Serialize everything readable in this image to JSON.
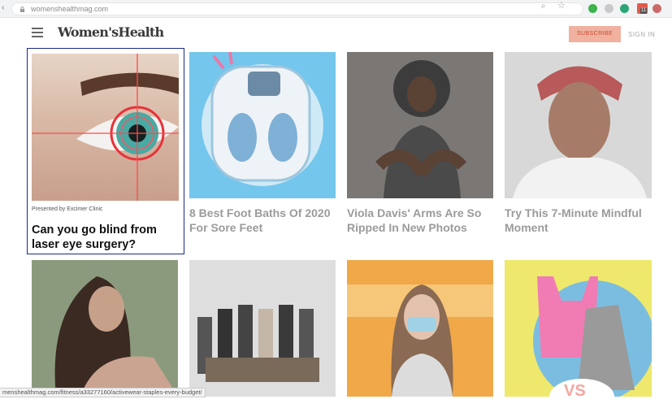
{
  "browser": {
    "url": "womenshealthmag.com",
    "status_url": "menshealthmag.com/fitness/a33277160/activewear-staples-every-budget/"
  },
  "header": {
    "logo": "Women'sHealth",
    "subscribe_label": "SUBSCRIBE",
    "signin_label": "SIGN IN"
  },
  "cards": [
    {
      "sponsor": "Presented by Excimer Clinic",
      "title": "Can you go blind from laser eye surgery?"
    },
    {
      "title": "8 Best Foot Baths Of 2020 For Sore Feet"
    },
    {
      "title": "Viola Davis' Arms Are So Ripped In New Photos"
    },
    {
      "title": "Try This 7-Minute Mindful Moment"
    }
  ],
  "bottom_tiles": [
    {
      "overlay_text": ""
    },
    {
      "overlay_text": ""
    },
    {
      "overlay_text": ""
    },
    {
      "overlay_text": "VS"
    }
  ],
  "colors": {
    "accent": "#f0b19f",
    "subscribe_text": "#c94a30",
    "featured_border": "#1a2a8c"
  },
  "icons": [
    "lock-icon",
    "zoom-icon",
    "star-icon",
    "hamburger-menu-icon"
  ]
}
